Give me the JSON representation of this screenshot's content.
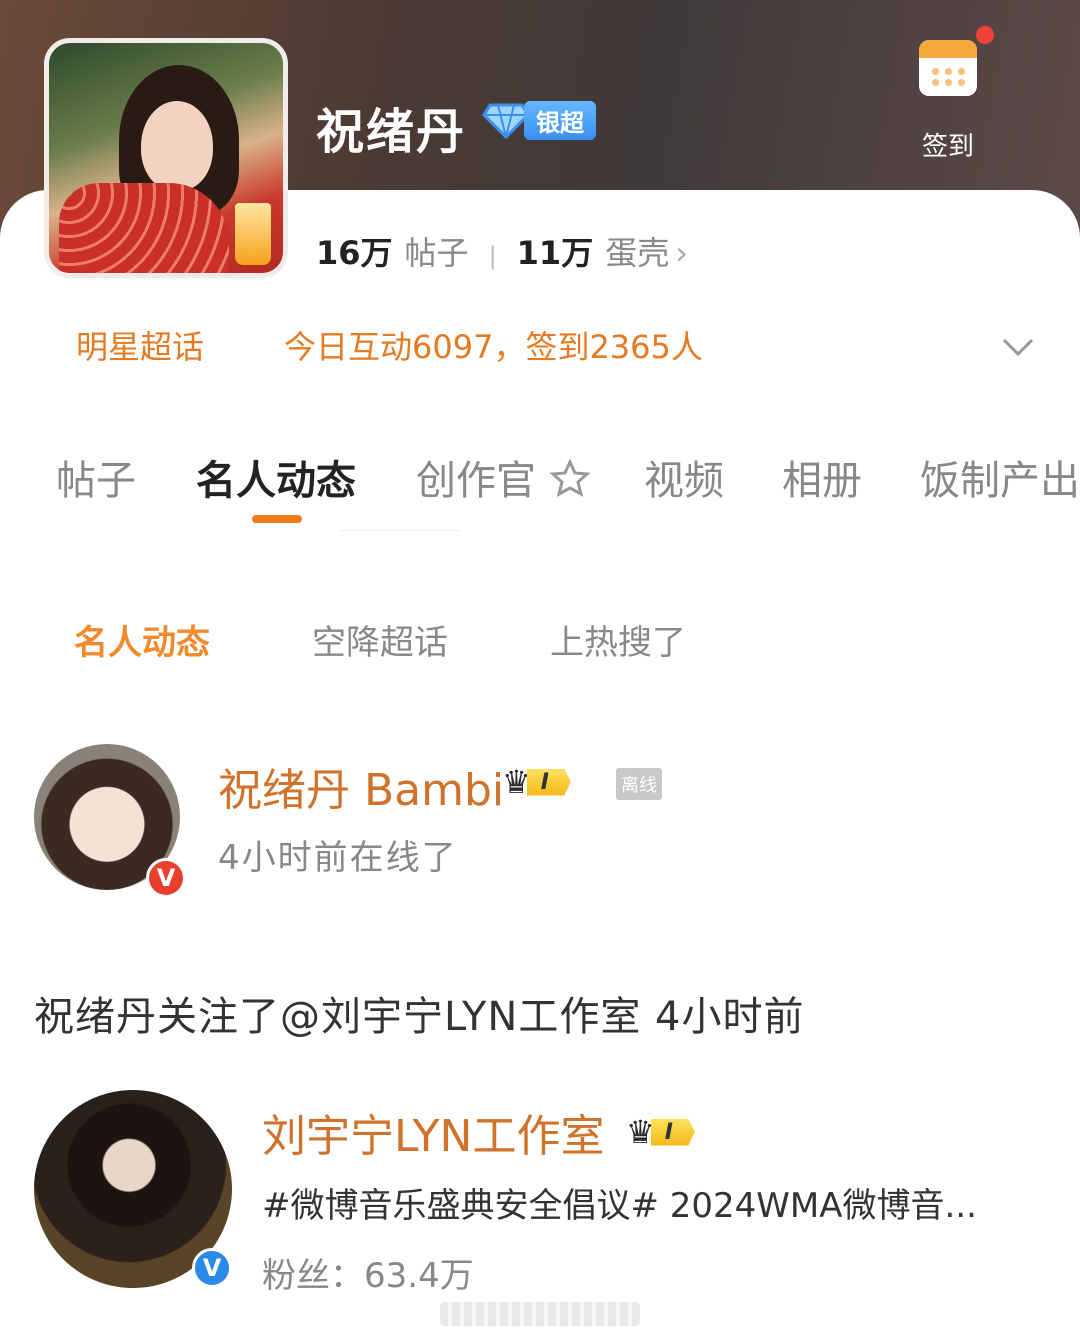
{
  "header": {
    "topic_name": "祝绪丹",
    "badge_label": "银超",
    "checkin_label": "签到"
  },
  "stats": {
    "posts_count": "16万",
    "posts_label": "帖子",
    "eggs_count": "11万",
    "eggs_label": "蛋壳"
  },
  "meta": {
    "category_tag": "明星超话",
    "daily_info": "今日互动6097，签到2365人"
  },
  "tabs": [
    {
      "label": "帖子"
    },
    {
      "label": "名人动态"
    },
    {
      "label": "创作官"
    },
    {
      "label": "视频"
    },
    {
      "label": "相册"
    },
    {
      "label": "饭制产出"
    }
  ],
  "subtabs": [
    {
      "label": "名人动态"
    },
    {
      "label": "空降超话"
    },
    {
      "label": "上热搜了"
    }
  ],
  "celebrity": {
    "name": "祝绪丹 Bambi",
    "level": "I",
    "status_badge": "离线",
    "last_online": "4小时前在线了"
  },
  "activity_text": "祝绪丹关注了@刘宇宁LYN工作室 4小时前",
  "followed_account": {
    "name": "刘宇宁LYN工作室",
    "level": "I",
    "description": "#微博音乐盛典安全倡议# 2024WMA微博音...",
    "fans": "粉丝：63.4万"
  },
  "colors": {
    "accent_orange": "#f08a2c",
    "name_orange": "#d0722a",
    "badge_blue": "#3a8ff0",
    "verify_red": "#e8402f",
    "verify_blue": "#2a8ae8",
    "notify_red": "#f0413b"
  },
  "icons": {
    "checkin": "calendar-icon",
    "dropdown": "chevron-down-icon",
    "stats_more": "chevron-right-icon",
    "creator_tab": "star-badge-icon",
    "badge": "diamond-icon",
    "level": "crown-icon"
  }
}
